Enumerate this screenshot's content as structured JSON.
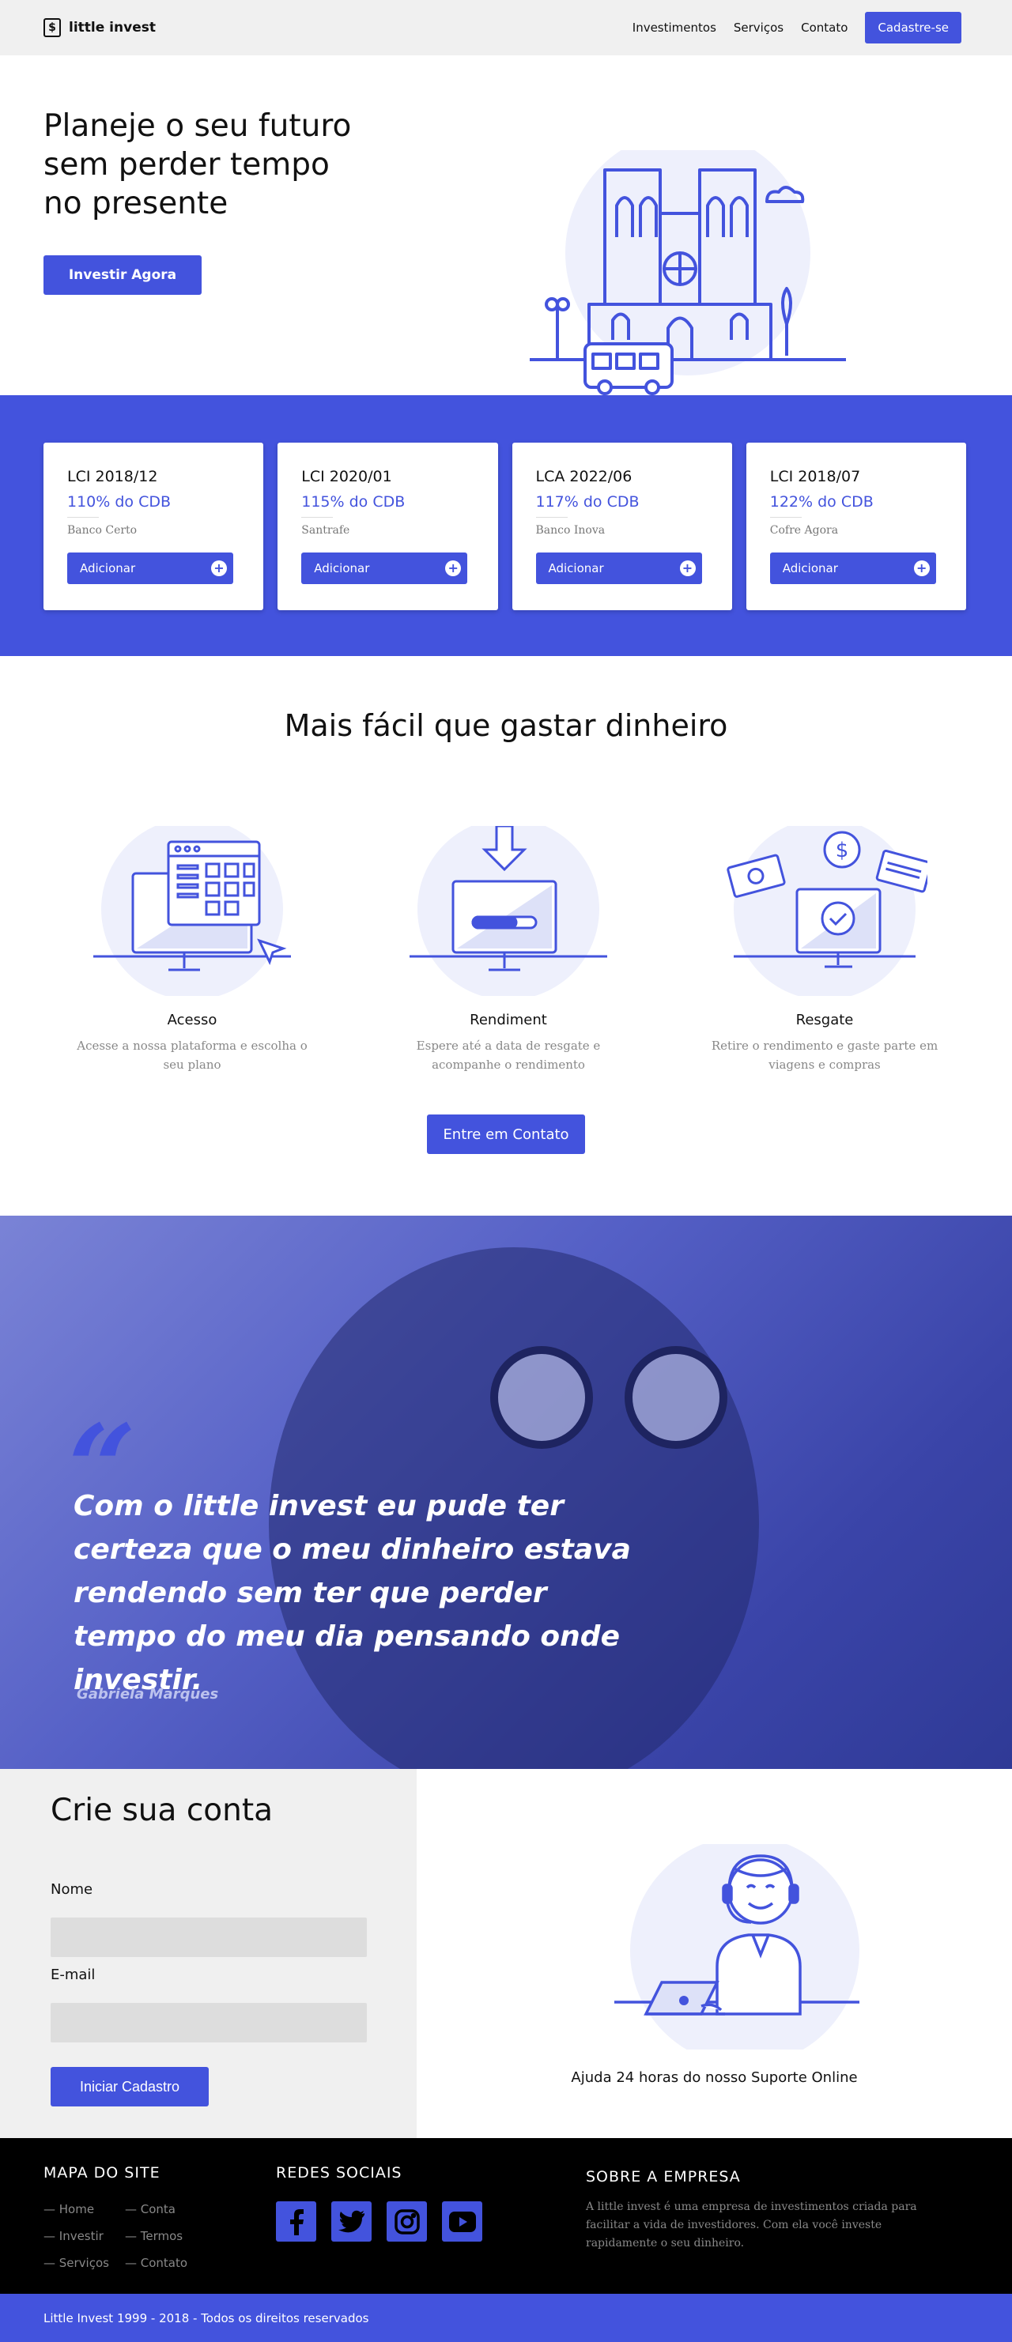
{
  "brand": {
    "logo_symbol": "$",
    "name": "little invest"
  },
  "nav": {
    "items": [
      "Investimentos",
      "Serviços",
      "Contato"
    ],
    "signup_label": "Cadastre-se"
  },
  "hero": {
    "title": "Planeje o seu futuro sem perder tempo no presente",
    "cta_label": "Investir Agora",
    "illustration": "cathedral-bus-illustration"
  },
  "offers": {
    "add_label": "Adicionar",
    "add_icon": "plus-circle-icon",
    "cards": [
      {
        "title": "LCI 2018/12",
        "rate": "110% do CDB",
        "bank": "Banco Certo"
      },
      {
        "title": "LCI 2020/01",
        "rate": "115% do CDB",
        "bank": "Santrafe"
      },
      {
        "title": "LCA 2022/06",
        "rate": "117% do CDB",
        "bank": "Banco Inova"
      },
      {
        "title": "LCI 2018/07",
        "rate": "122% do CDB",
        "bank": "Cofre Agora"
      }
    ]
  },
  "features": {
    "title": "Mais fácil que gastar dinheiro",
    "items": [
      {
        "icon": "computer-dashboard-icon",
        "title": "Acesso",
        "desc": "Acesse a nossa plataforma e escolha o seu plano"
      },
      {
        "icon": "computer-download-icon",
        "title": "Rendiment",
        "desc": "Espere até a data de resgate e acompanhe o rendimento"
      },
      {
        "icon": "computer-money-icon",
        "title": "Resgate",
        "desc": "Retire o rendimento e gaste parte em viagens e compras"
      }
    ],
    "cta_label": "Entre em Contato"
  },
  "testimonial": {
    "quote_mark": "“",
    "text": "Com o little invest eu pude ter certeza que o meu dinheiro estava rendendo sem ter que perder tempo do meu dia pensando onde investir.",
    "author": "Gabriela Marques"
  },
  "signup": {
    "title": "Crie sua conta",
    "name_label": "Nome",
    "email_label": "E-mail",
    "name_value": "",
    "email_value": "",
    "submit_label": "Iniciar Cadastro",
    "support_text": "Ajuda 24 horas do nosso Suporte Online"
  },
  "footer": {
    "sitemap_title": "MAPA DO SITE",
    "sitemap_col1": [
      "— Home",
      "— Investir",
      "— Serviços"
    ],
    "sitemap_col2": [
      "— Conta",
      "— Termos",
      "— Contato"
    ],
    "social_title": "REDES SOCIAIS",
    "socials": [
      "facebook-icon",
      "twitter-icon",
      "instagram-icon",
      "youtube-icon"
    ],
    "about_title": "SOBRE A EMPRESA",
    "about_text": "A little invest é uma empresa de investimentos criada para facilitar a vida de investidores. Com ela você investe rapidamente o seu dinheiro.",
    "copyright": "Little Invest 1999 - 2018 - Todos os direitos reservados"
  },
  "colors": {
    "accent": "#4353dd",
    "light_bg": "#f0f0f0",
    "footer_bg": "#000000"
  }
}
